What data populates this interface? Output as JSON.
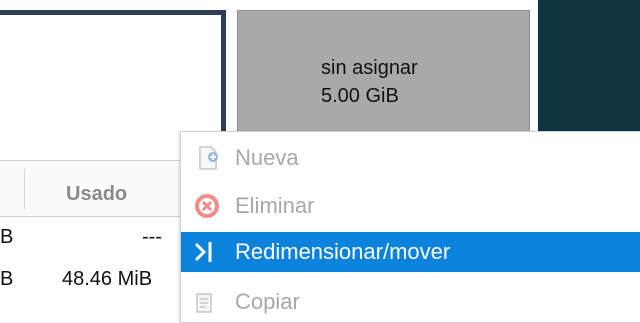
{
  "partition_map": {
    "unallocated_label": "sin asignar",
    "unallocated_size": "5.00 GiB"
  },
  "table": {
    "header_used": "Usado",
    "rows": [
      {
        "size_suffix": "B",
        "used": "---"
      },
      {
        "size_suffix": "B",
        "used": "48.46 MiB"
      }
    ]
  },
  "context_menu": {
    "items": [
      {
        "label": "Nueva",
        "icon": "new-document-icon",
        "enabled": false
      },
      {
        "label": "Eliminar",
        "icon": "delete-icon",
        "enabled": false
      },
      {
        "label": "Redimensionar/mover",
        "icon": "resize-move-icon",
        "enabled": true,
        "highlighted": true
      },
      {
        "label": "Copiar",
        "icon": "copy-icon",
        "enabled": false
      }
    ]
  },
  "colors": {
    "highlight": "#0b82db",
    "dark_panel": "#0f3640",
    "unallocated": "#a9a9a9",
    "selection_border": "#2d3f57"
  }
}
